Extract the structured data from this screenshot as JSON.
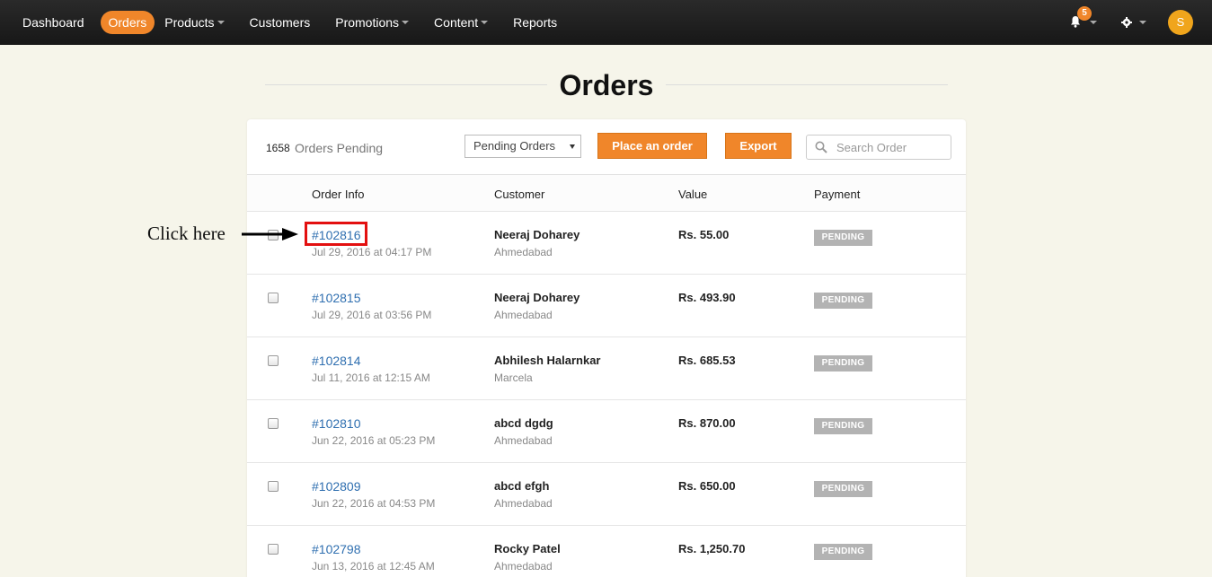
{
  "nav": {
    "items": [
      {
        "label": "Dashboard",
        "active": false,
        "dropdown": false
      },
      {
        "label": "Orders",
        "active": true,
        "dropdown": false
      },
      {
        "label": "Products",
        "active": false,
        "dropdown": true
      },
      {
        "label": "Customers",
        "active": false,
        "dropdown": false
      },
      {
        "label": "Promotions",
        "active": false,
        "dropdown": true
      },
      {
        "label": "Content",
        "active": false,
        "dropdown": true
      },
      {
        "label": "Reports",
        "active": false,
        "dropdown": false
      }
    ],
    "notification_count": "5",
    "avatar_letter": "S",
    "accent_color": "#f0862a"
  },
  "page": {
    "title": "Orders"
  },
  "toolbar": {
    "pending_count": "1658",
    "pending_label": "Orders Pending",
    "filter_selected": "Pending Orders",
    "place_order_label": "Place an order",
    "export_label": "Export",
    "search_placeholder": "Search Order"
  },
  "table": {
    "columns": [
      "Order Info",
      "Customer",
      "Value",
      "Payment"
    ],
    "rows": [
      {
        "id": "#102816",
        "date": "Jul 29, 2016 at 04:17 PM",
        "customer": "Neeraj Doharey",
        "city": "Ahmedabad",
        "value": "Rs. 55.00",
        "payment": "PENDING"
      },
      {
        "id": "#102815",
        "date": "Jul 29, 2016 at 03:56 PM",
        "customer": "Neeraj Doharey",
        "city": "Ahmedabad",
        "value": "Rs. 493.90",
        "payment": "PENDING"
      },
      {
        "id": "#102814",
        "date": "Jul 11, 2016 at 12:15 AM",
        "customer": "Abhilesh Halarnkar",
        "city": "Marcela",
        "value": "Rs. 685.53",
        "payment": "PENDING"
      },
      {
        "id": "#102810",
        "date": "Jun 22, 2016 at 05:23 PM",
        "customer": "abcd dgdg",
        "city": "Ahmedabad",
        "value": "Rs. 870.00",
        "payment": "PENDING"
      },
      {
        "id": "#102809",
        "date": "Jun 22, 2016 at 04:53 PM",
        "customer": "abcd efgh",
        "city": "Ahmedabad",
        "value": "Rs. 650.00",
        "payment": "PENDING"
      },
      {
        "id": "#102798",
        "date": "Jun 13, 2016 at 12:45 AM",
        "customer": "Rocky Patel",
        "city": "Ahmedabad",
        "value": "Rs. 1,250.70",
        "payment": "PENDING"
      }
    ]
  },
  "annotation": {
    "text": "Click here",
    "box_color": "#e31010"
  },
  "icons": {
    "bell": "bell-icon",
    "settings": "gear-icon",
    "search": "search-icon"
  }
}
